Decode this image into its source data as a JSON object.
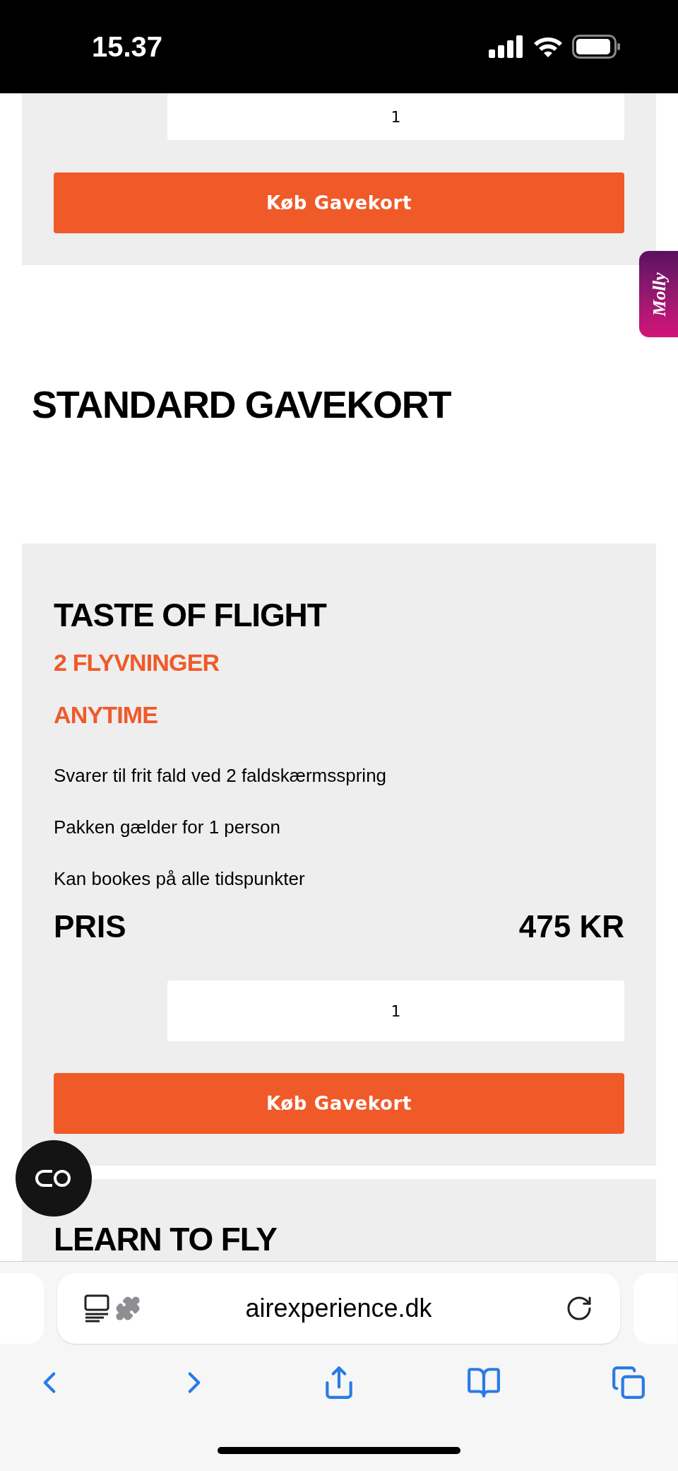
{
  "status_bar": {
    "time": "15.37"
  },
  "top_card": {
    "quantity": "1",
    "button": "Køb Gavekort"
  },
  "molly_tab": {
    "label": "Molly"
  },
  "section_title": "STANDARD GAVEKORT",
  "products": [
    {
      "title": "TASTE OF FLIGHT",
      "subtitle": "2 FLYVNINGER",
      "tag": "ANYTIME",
      "features": [
        "Svarer til frit fald ved 2 faldskærmsspring",
        "Pakken gælder for 1 person",
        "Kan bookes på alle tidspunkter"
      ],
      "price_label": "PRIS",
      "price": "475 KR",
      "quantity": "1",
      "button": "Køb Gavekort"
    }
  ],
  "next_product": {
    "title": "LEARN TO FLY"
  },
  "browser": {
    "url": "airexperience.dk"
  }
}
